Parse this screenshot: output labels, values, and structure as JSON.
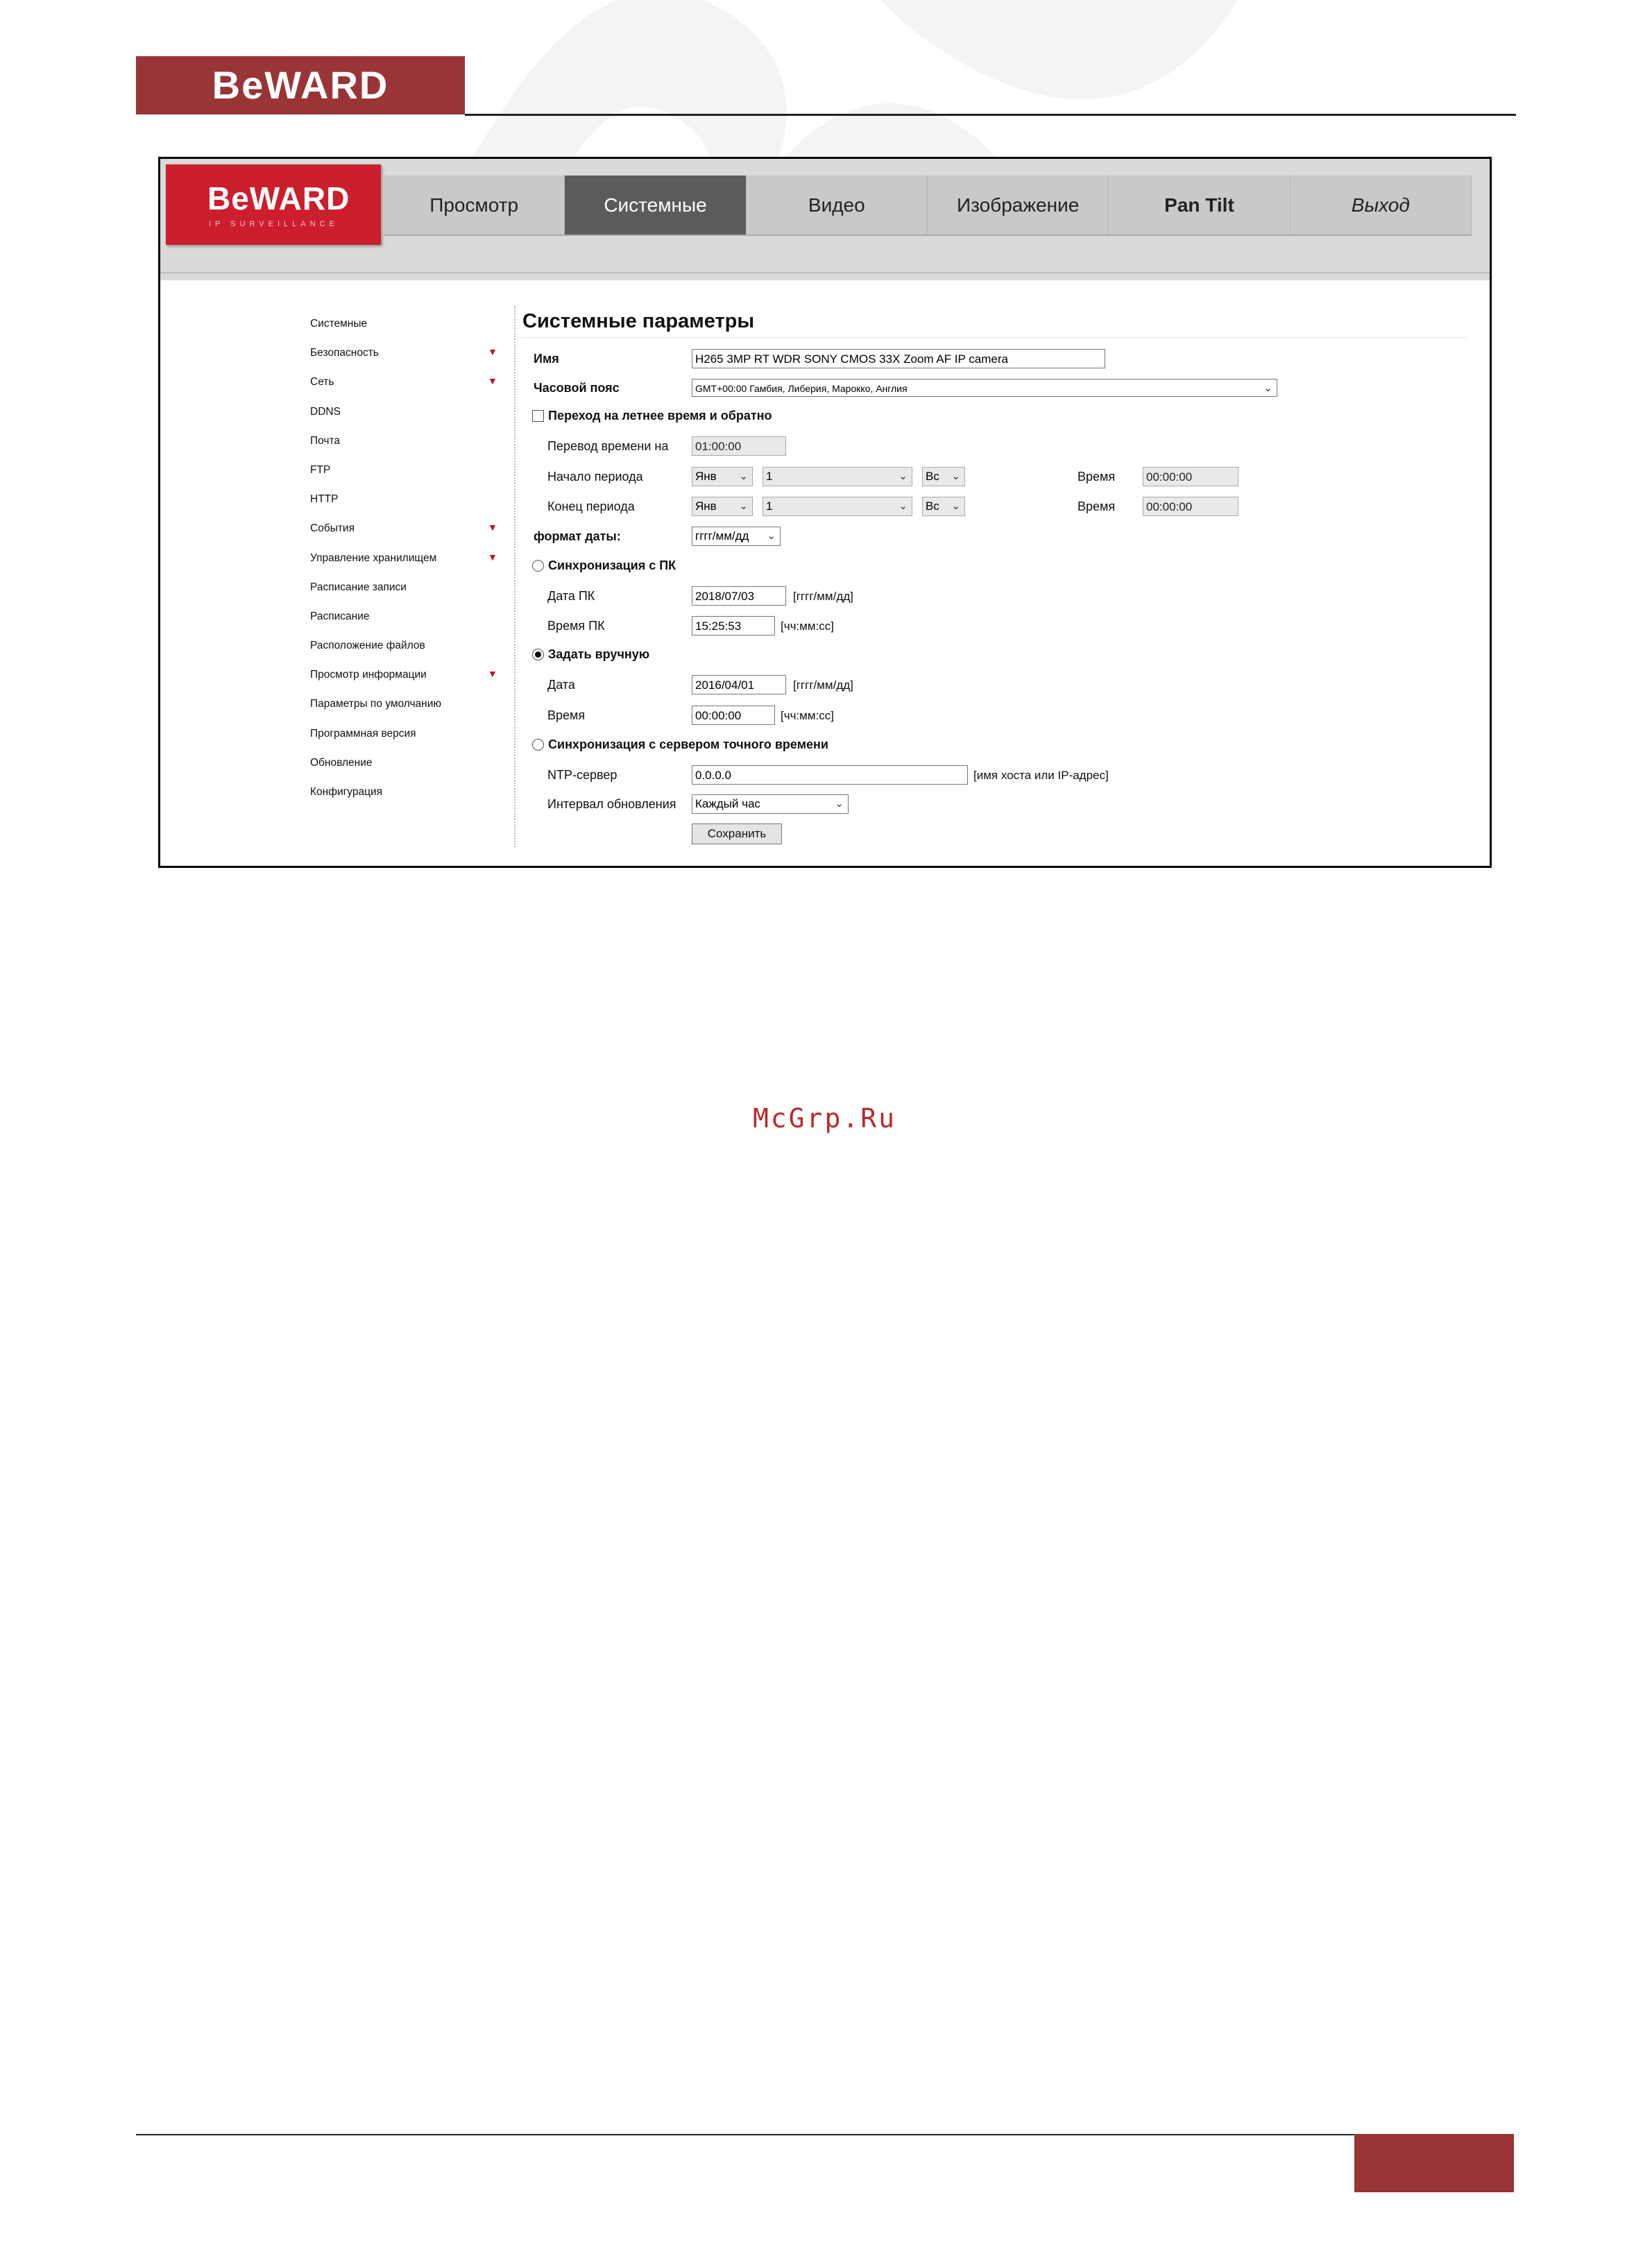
{
  "page": {
    "top_logo": "BeWARD",
    "watermark": "BeWARD",
    "watermark_text": "McGrp.Ru"
  },
  "camera": {
    "logo": "BeWARD",
    "logo_sub": "IP SURVEILLANCE"
  },
  "nav": [
    "Просмотр",
    "Системные",
    "Видео",
    "Изображение",
    "Pan Tilt",
    "Выход"
  ],
  "sidebar": {
    "items": [
      {
        "label": "Системные",
        "arrow": ""
      },
      {
        "label": "Безопасность",
        "arrow": "▼"
      },
      {
        "label": "Сеть",
        "arrow": "▼"
      },
      {
        "label": "DDNS",
        "arrow": ""
      },
      {
        "label": "Почта",
        "arrow": ""
      },
      {
        "label": "FTP",
        "arrow": ""
      },
      {
        "label": "HTTP",
        "arrow": ""
      },
      {
        "label": "События",
        "arrow": "▼"
      },
      {
        "label": "Управление хранилищем",
        "arrow": "▼"
      },
      {
        "label": "Расписание записи",
        "arrow": ""
      },
      {
        "label": "Расписание",
        "arrow": ""
      },
      {
        "label": "Расположение файлов",
        "arrow": ""
      },
      {
        "label": "Просмотр информации",
        "arrow": "▼"
      },
      {
        "label": "Параметры по умолчанию",
        "arrow": ""
      },
      {
        "label": "Программная версия",
        "arrow": ""
      },
      {
        "label": "Обновление",
        "arrow": ""
      },
      {
        "label": "Конфигурация",
        "arrow": ""
      }
    ]
  },
  "form": {
    "title": "Системные параметры",
    "name_label": "Имя",
    "name_value": "H265 3MP RT WDR SONY CMOS 33X Zoom AF IP camera",
    "timezone_label": "Часовой пояс",
    "timezone_value": "GMT+00:00 Гамбия, Либерия, Марокко, Англия",
    "dst_label": "Переход на летнее время и обратно",
    "dst_checked": false,
    "shift_label": "Перевод времени на",
    "shift_value": "01:00:00",
    "start_label": "Начало периода",
    "start_month": "Янв",
    "start_week": "1",
    "start_day": "Вс",
    "start_time_label": "Время",
    "start_time": "00:00:00",
    "end_label": "Конец периода",
    "end_month": "Янв",
    "end_week": "1",
    "end_day": "Вс",
    "end_time_label": "Время",
    "end_time": "00:00:00",
    "date_format_label": "формат даты:",
    "date_format_value": "гггг/мм/дд",
    "sync_pc_label": "Синхронизация с ПК",
    "pc_date_label": "Дата ПК",
    "pc_date_value": "2018/07/03",
    "pc_date_hint": "[гггг/мм/дд]",
    "pc_time_label": "Время ПК",
    "pc_time_value": "15:25:53",
    "pc_time_hint": "[чч:мм:сс]",
    "manual_label": "Задать вручную",
    "manual_date_label": "Дата",
    "manual_date_value": "2016/04/01",
    "manual_date_hint": "[гггг/мм/дд]",
    "manual_time_label": "Время",
    "manual_time_value": "00:00:00",
    "manual_time_hint": "[чч:мм:сс]",
    "ntp_sync_label": "Синхронизация с сервером точного времени",
    "ntp_label": "NTP-сервер",
    "ntp_value": "0.0.0.0",
    "ntp_hint": "[имя хоста или IP-адрес]",
    "interval_label": "Интервал обновления",
    "interval_value": "Каждый час",
    "save_label": "Сохранить",
    "selected_mode": "manual"
  }
}
